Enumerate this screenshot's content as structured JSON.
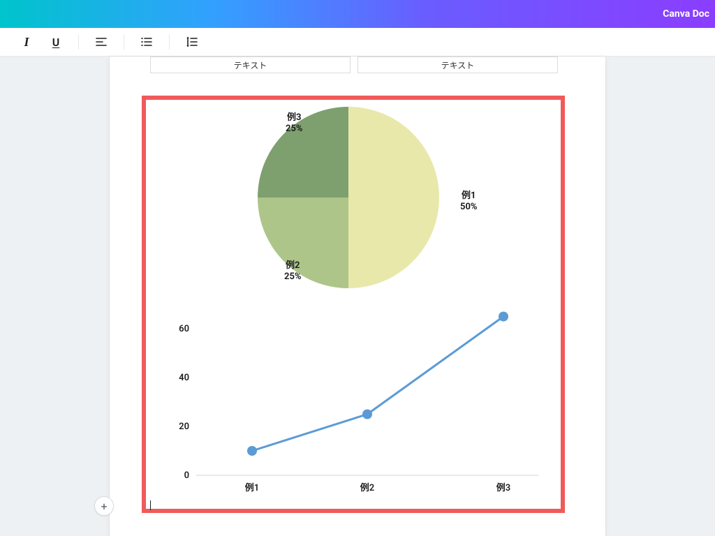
{
  "app": {
    "title": "Canva Doc"
  },
  "toolbar": {
    "italic_glyph": "I",
    "underline_glyph": "U"
  },
  "templates": {
    "left_label": "テキスト",
    "right_label": "テキスト"
  },
  "pie": {
    "labels": {
      "s1_name": "例1",
      "s1_pct": "50%",
      "s2_name": "例2",
      "s2_pct": "25%",
      "s3_name": "例3",
      "s3_pct": "25%"
    }
  },
  "line": {
    "y_ticks": {
      "t0": "0",
      "t20": "20",
      "t40": "40",
      "t60": "60"
    },
    "x_ticks": {
      "c1": "例1",
      "c2": "例2",
      "c3": "例3"
    }
  },
  "add_button": {
    "glyph": "+"
  },
  "chart_data": [
    {
      "type": "pie",
      "title": "",
      "series": [
        {
          "name": "例1",
          "value": 50,
          "color": "#e8e8ab"
        },
        {
          "name": "例2",
          "value": 25,
          "color": "#aec58a"
        },
        {
          "name": "例3",
          "value": 25,
          "color": "#7ea06e"
        }
      ]
    },
    {
      "type": "line",
      "title": "",
      "categories": [
        "例1",
        "例2",
        "例3"
      ],
      "series": [
        {
          "name": "",
          "values": [
            10,
            25,
            65
          ],
          "color": "#5b9bd5"
        }
      ],
      "xlabel": "",
      "ylabel": "",
      "ylim": [
        0,
        70
      ],
      "y_ticks": [
        0,
        20,
        40,
        60
      ]
    }
  ]
}
